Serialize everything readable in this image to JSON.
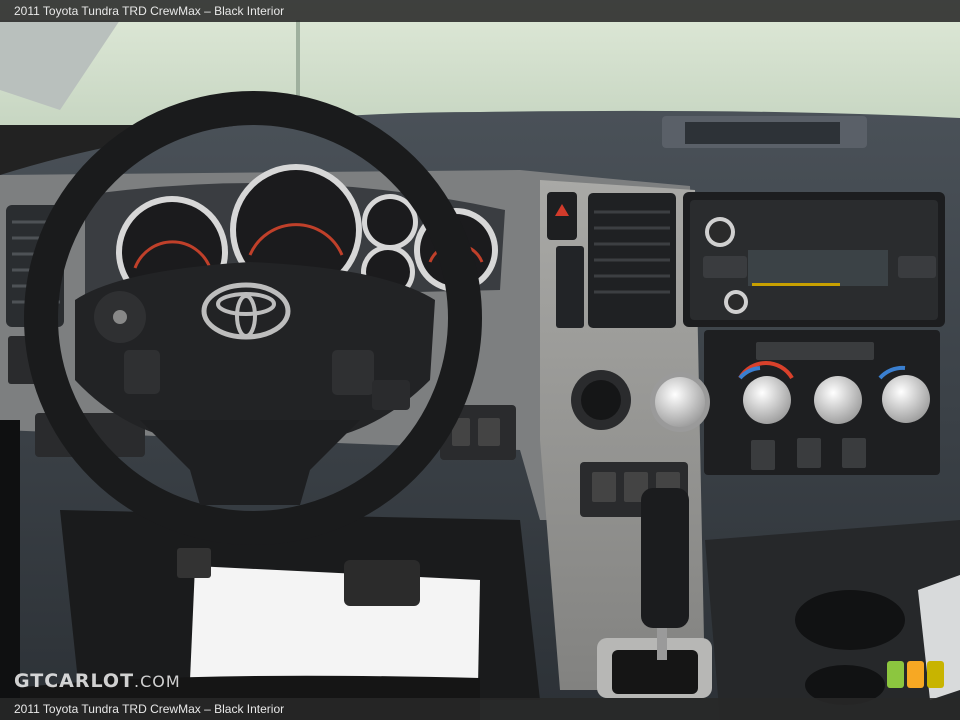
{
  "caption": "2011 Toyota Tundra TRD CrewMax – Black Interior",
  "watermark": {
    "brand": "GTCARLOT",
    "suffix": ".COM"
  },
  "logo_colors": [
    "#8cc63f",
    "#f7a823",
    "#c8b400"
  ],
  "icons": {
    "steering_wheel": "toyota-steering-wheel",
    "gauges": "instrument-cluster",
    "radio": "audio-head-unit",
    "shifter": "gear-shifter"
  }
}
